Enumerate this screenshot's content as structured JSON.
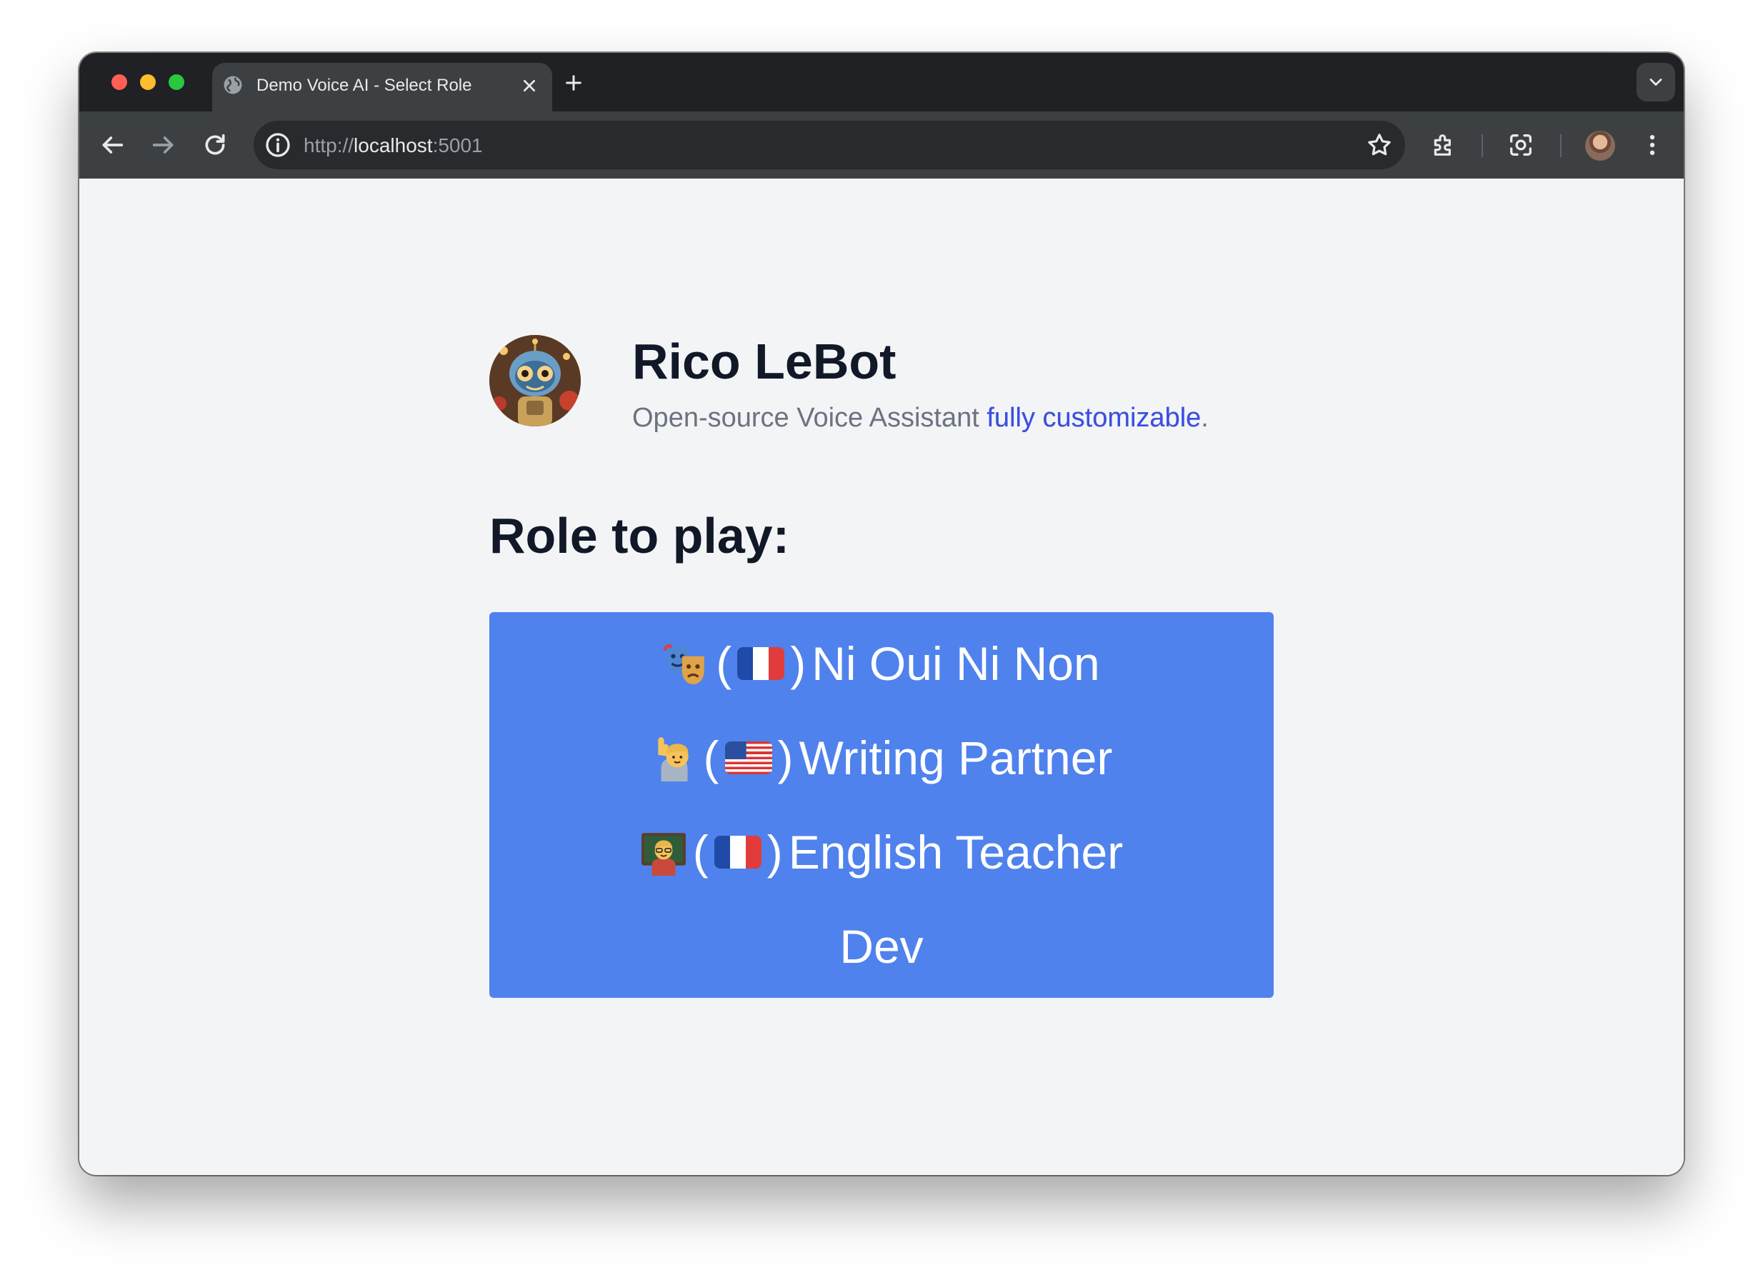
{
  "browser": {
    "tab_title": "Demo Voice AI - Select Role",
    "url_scheme": "http://",
    "url_host": "localhost",
    "url_port": ":5001"
  },
  "page": {
    "app_title": "Rico LeBot",
    "subtitle_plain": "Open-source Voice Assistant ",
    "subtitle_highlight": "fully customizable",
    "subtitle_end": ".",
    "section_heading": "Role to play:",
    "roles": [
      {
        "emoji": "performing-arts",
        "flag": "fr",
        "label": "(🇫🇷) Ni Oui Ni Non",
        "text": "Ni Oui Ni Non"
      },
      {
        "emoji": "person-raising-hand",
        "flag": "us",
        "label": "(🇺🇸) Writing Partner",
        "text": "Writing Partner"
      },
      {
        "emoji": "teacher",
        "flag": "fr",
        "label": "(🇫🇷) English Teacher",
        "text": "English Teacher"
      },
      {
        "emoji": "",
        "flag": "",
        "label": "Dev",
        "text": "Dev"
      }
    ]
  },
  "colors": {
    "button_bg": "#4f82ec",
    "page_bg": "#f3f4f6",
    "accent_start": "#2563eb",
    "accent_end": "#4f46e5"
  }
}
